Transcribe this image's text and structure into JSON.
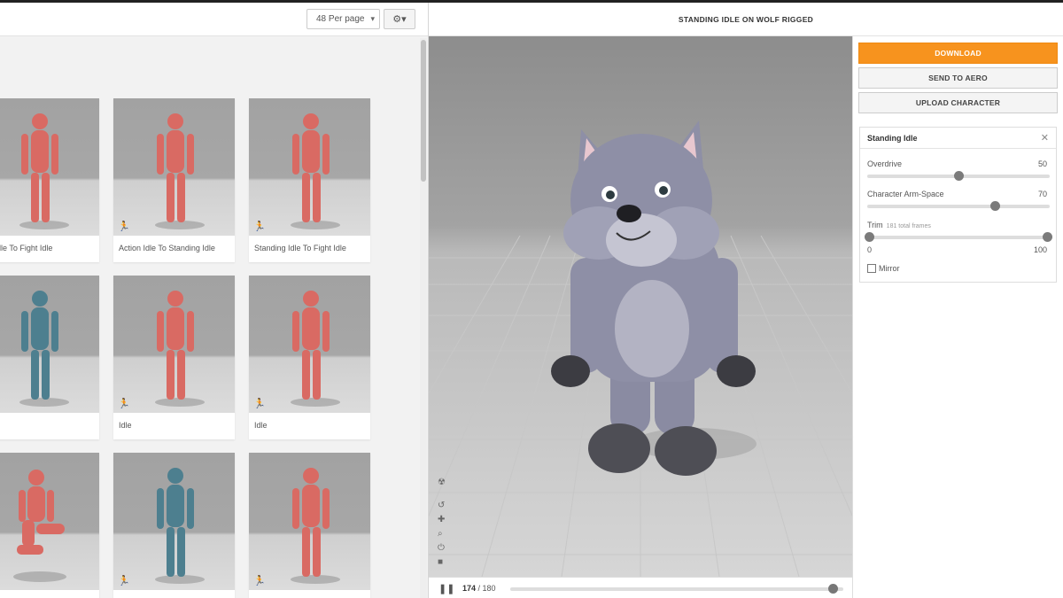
{
  "toolbar": {
    "per_page": "48 Per page",
    "settings_icon": "gear-icon"
  },
  "cards": [
    {
      "caption": "on Idle To Fight Idle",
      "figure": "red"
    },
    {
      "caption": "Action Idle To Standing Idle",
      "figure": "red"
    },
    {
      "caption": "Standing Idle To Fight Idle",
      "figure": "red"
    },
    {
      "caption": "",
      "figure": "blue"
    },
    {
      "caption": "Idle",
      "figure": "red"
    },
    {
      "caption": "Idle",
      "figure": "red"
    },
    {
      "caption": "",
      "figure": "red-kneel"
    },
    {
      "caption": "",
      "figure": "blue"
    },
    {
      "caption": "",
      "figure": "red"
    }
  ],
  "viewer": {
    "title": "STANDING IDLE ON WOLF RIGGED",
    "frame_current": "174",
    "frame_total": " / 180",
    "progress": 0.967
  },
  "actions": {
    "download": "DOWNLOAD",
    "send_aero": "SEND TO AERO",
    "upload": "UPLOAD CHARACTER"
  },
  "settings": {
    "title": "Standing Idle",
    "overdrive": {
      "label": "Overdrive",
      "value": "50",
      "fraction": 0.5
    },
    "armspace": {
      "label": "Character Arm-Space",
      "value": "70",
      "fraction": 0.7
    },
    "trim": {
      "label": "Trim",
      "sub": "181 total frames",
      "min": "0",
      "max": "100"
    },
    "mirror": "Mirror"
  },
  "colors": {
    "accent": "#f7931e",
    "red_figure": "#d96a63",
    "blue_figure": "#4d7f8f",
    "wolf": "#8e8fa6"
  }
}
